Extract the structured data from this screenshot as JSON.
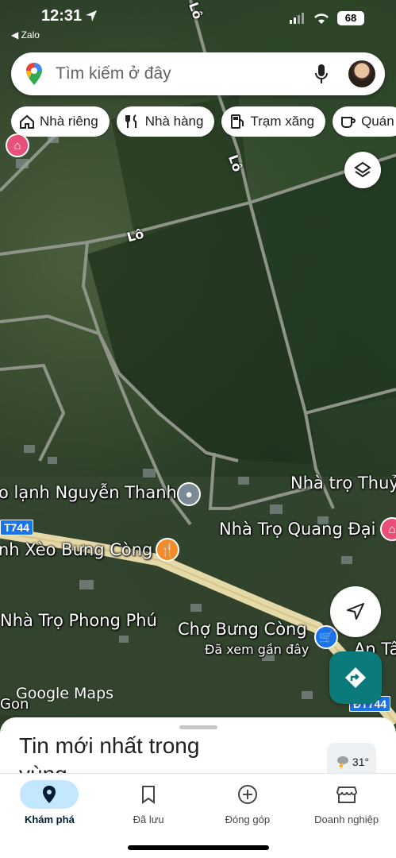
{
  "status_bar": {
    "time": "12:31",
    "back_app": "◀ Zalo",
    "battery": "68"
  },
  "search": {
    "placeholder": "Tìm kiếm ở đây"
  },
  "chips": [
    {
      "label": "Nhà riêng",
      "icon": "home-icon"
    },
    {
      "label": "Nhà hàng",
      "icon": "restaurant-icon"
    },
    {
      "label": "Trạm xăng",
      "icon": "gas-station-icon"
    },
    {
      "label": "Quán",
      "icon": "coffee-icon"
    }
  ],
  "map": {
    "road_labels": [
      "Lô",
      "Lô",
      "Lô"
    ],
    "places": [
      "o lạnh Nguyễn Thanh",
      "Nhà trọ Thuỷ",
      "Nhà Trọ Quang Đại",
      "nh Xèo Bưng Còng",
      "Nhà Trọ Phong Phú",
      "Chợ Bưng Còng",
      "An Tâ"
    ],
    "place_subtitle": "Đã xem gần đây",
    "route_badges": [
      "T744",
      "ĐT744"
    ],
    "area_label": "Gon",
    "attribution": "Google Maps"
  },
  "sheet": {
    "title": "Tin mới nhất trong vùng",
    "weather_temp": "31°"
  },
  "nav": {
    "items": [
      {
        "label": "Khám phá",
        "icon": "explore-pin-icon",
        "active": true
      },
      {
        "label": "Đã lưu",
        "icon": "bookmark-icon",
        "active": false
      },
      {
        "label": "Đóng góp",
        "icon": "add-circle-icon",
        "active": false
      },
      {
        "label": "Doanh nghiệp",
        "icon": "storefront-icon",
        "active": false
      }
    ]
  },
  "colors": {
    "accent": "#0b7a7a",
    "nav_active": "#c2e7ff",
    "pin_food": "#f28c28",
    "pin_shop": "#1a73e8",
    "pin_lodging": "#e8507a"
  }
}
